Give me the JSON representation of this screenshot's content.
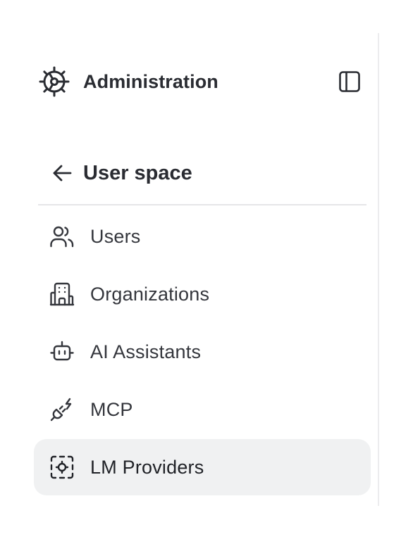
{
  "header": {
    "title": "Administration",
    "icon": "gear-icon",
    "toggle_icon": "sidebar-panel-icon"
  },
  "section": {
    "back_icon": "arrow-left-icon",
    "label": "User space"
  },
  "nav": {
    "items": [
      {
        "label": "Users",
        "icon": "users-icon",
        "active": false
      },
      {
        "label": "Organizations",
        "icon": "building-icon",
        "active": false
      },
      {
        "label": "AI Assistants",
        "icon": "bot-icon",
        "active": false
      },
      {
        "label": "MCP",
        "icon": "plug-icon",
        "active": false
      },
      {
        "label": "LM Providers",
        "icon": "cpu-settings-icon",
        "active": true
      }
    ]
  },
  "colors": {
    "text": "#2a2c32",
    "active_bg": "#f0f1f2",
    "divider": "#e5e6e8"
  }
}
